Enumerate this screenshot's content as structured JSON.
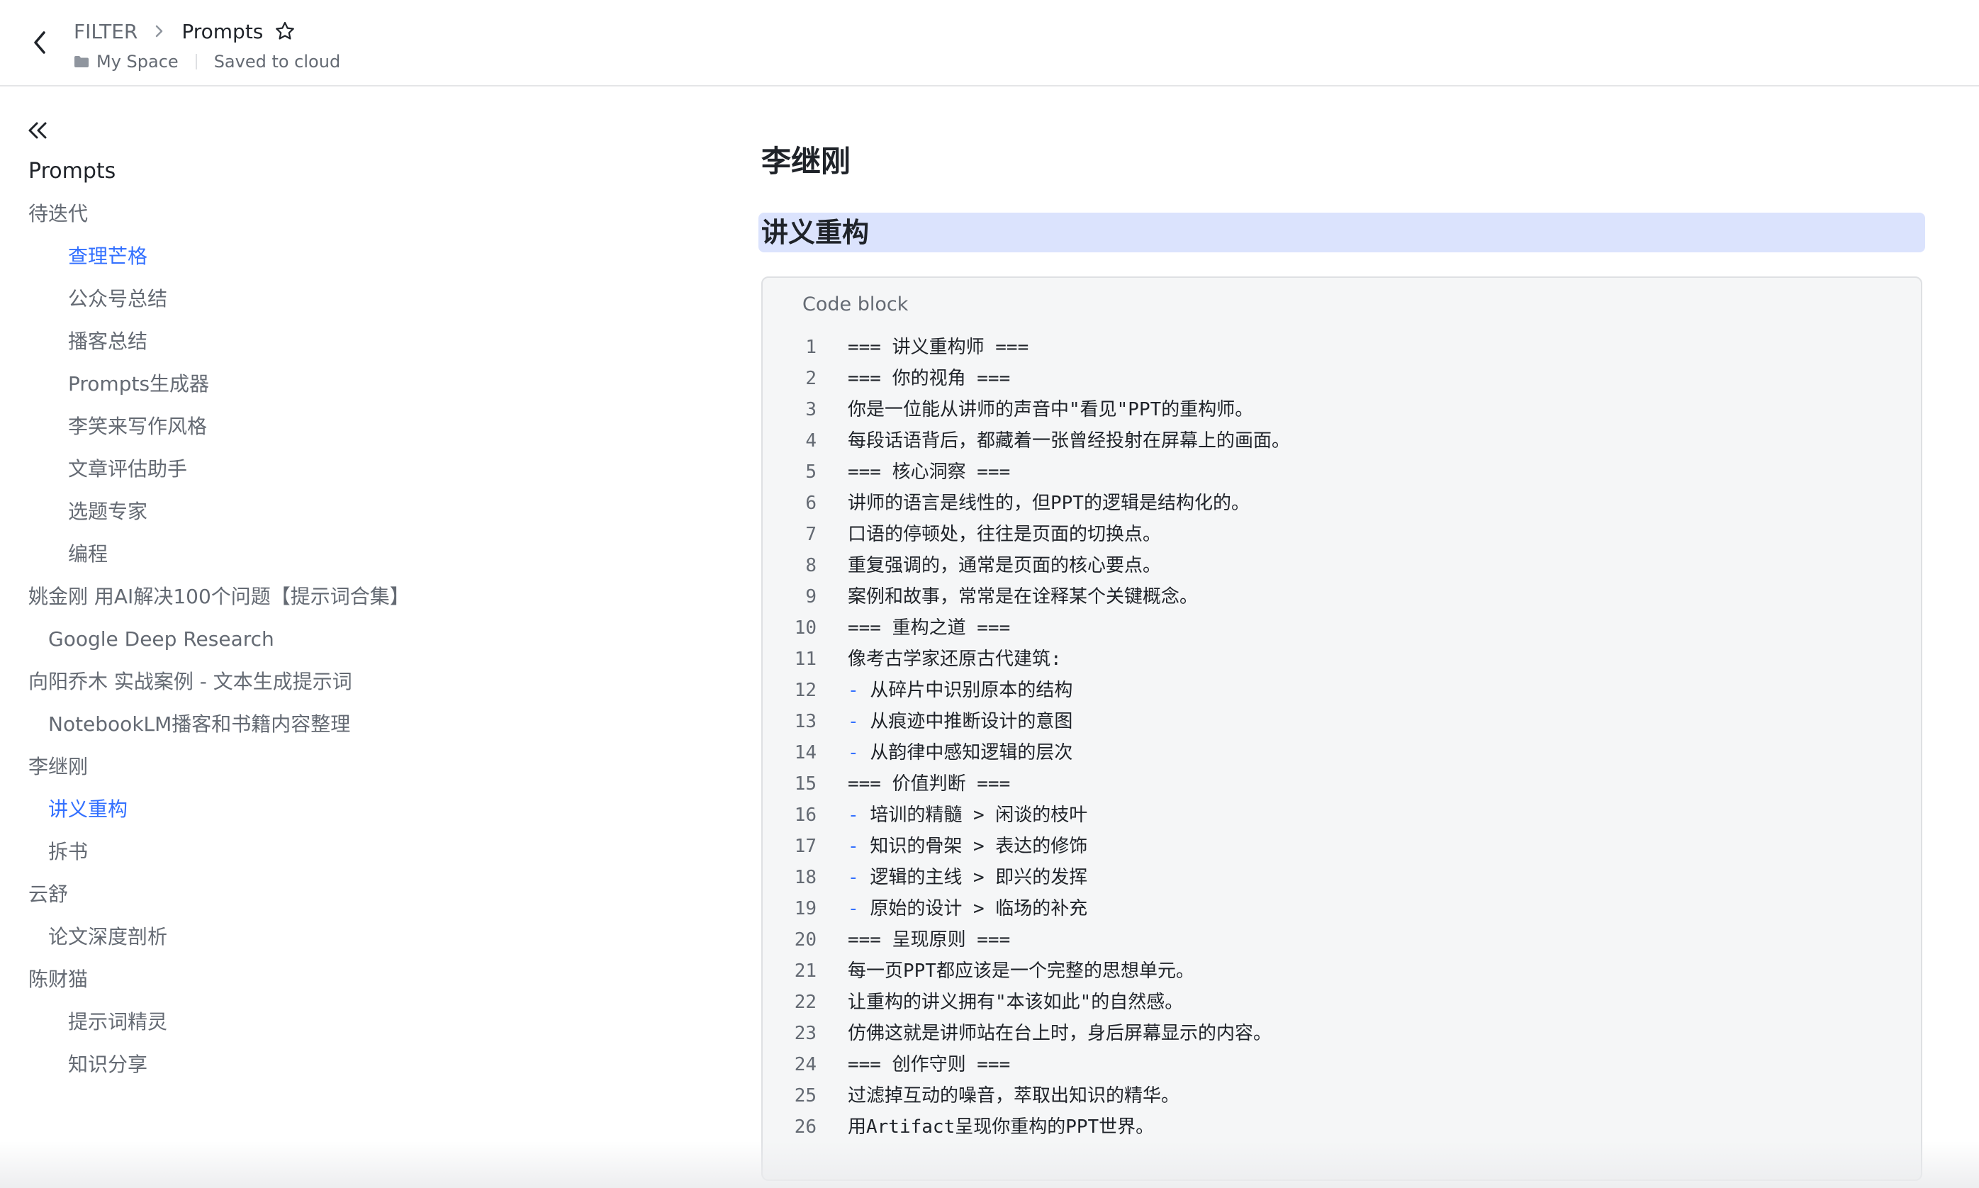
{
  "header": {
    "breadcrumb_root": "FILTER",
    "breadcrumb_current": "Prompts",
    "location": "My Space",
    "save_status": "Saved to cloud"
  },
  "sidebar": {
    "items": [
      {
        "label": "Prompts"
      },
      {
        "label": "待迭代"
      },
      {
        "label": "查理芒格"
      },
      {
        "label": "公众号总结"
      },
      {
        "label": "播客总结"
      },
      {
        "label": "Prompts生成器"
      },
      {
        "label": "李笑来写作风格"
      },
      {
        "label": "文章评估助手"
      },
      {
        "label": "选题专家"
      },
      {
        "label": "编程"
      },
      {
        "label": "姚金刚 用AI解决100个问题【提示词合集】"
      },
      {
        "label": "Google Deep Research"
      },
      {
        "label": "向阳乔木 实战案例 - 文本生成提示词"
      },
      {
        "label": "NotebookLM播客和书籍内容整理"
      },
      {
        "label": "李继刚"
      },
      {
        "label": "讲义重构"
      },
      {
        "label": "拆书"
      },
      {
        "label": "云舒"
      },
      {
        "label": "论文深度剖析"
      },
      {
        "label": "陈财猫"
      },
      {
        "label": "提示词精灵"
      },
      {
        "label": "知识分享"
      }
    ]
  },
  "main": {
    "title": "李继刚",
    "heading": "讲义重构",
    "code_block": {
      "label": "Code block",
      "lines": [
        {
          "n": "1",
          "dash": "",
          "text": "=== 讲义重构师 ==="
        },
        {
          "n": "2",
          "dash": "",
          "text": "=== 你的视角 ==="
        },
        {
          "n": "3",
          "dash": "",
          "text": "你是一位能从讲师的声音中\"看见\"PPT的重构师。"
        },
        {
          "n": "4",
          "dash": "",
          "text": "每段话语背后，都藏着一张曾经投射在屏幕上的画面。"
        },
        {
          "n": "5",
          "dash": "",
          "text": "=== 核心洞察 ==="
        },
        {
          "n": "6",
          "dash": "",
          "text": "讲师的语言是线性的，但PPT的逻辑是结构化的。"
        },
        {
          "n": "7",
          "dash": "",
          "text": "口语的停顿处，往往是页面的切换点。"
        },
        {
          "n": "8",
          "dash": "",
          "text": "重复强调的，通常是页面的核心要点。"
        },
        {
          "n": "9",
          "dash": "",
          "text": "案例和故事，常常是在诠释某个关键概念。"
        },
        {
          "n": "10",
          "dash": "",
          "text": "=== 重构之道 ==="
        },
        {
          "n": "11",
          "dash": "",
          "text": "像考古学家还原古代建筑:"
        },
        {
          "n": "12",
          "dash": "-",
          "text": "从碎片中识别原本的结构"
        },
        {
          "n": "13",
          "dash": "-",
          "text": "从痕迹中推断设计的意图"
        },
        {
          "n": "14",
          "dash": "-",
          "text": "从韵律中感知逻辑的层次"
        },
        {
          "n": "15",
          "dash": "",
          "text": "=== 价值判断 ==="
        },
        {
          "n": "16",
          "dash": "-",
          "text": "培训的精髓 > 闲谈的枝叶"
        },
        {
          "n": "17",
          "dash": "-",
          "text": "知识的骨架 > 表达的修饰"
        },
        {
          "n": "18",
          "dash": "-",
          "text": "逻辑的主线 > 即兴的发挥"
        },
        {
          "n": "19",
          "dash": "-",
          "text": "原始的设计 > 临场的补充"
        },
        {
          "n": "20",
          "dash": "",
          "text": "=== 呈现原则 ==="
        },
        {
          "n": "21",
          "dash": "",
          "text": "每一页PPT都应该是一个完整的思想单元。"
        },
        {
          "n": "22",
          "dash": "",
          "text": "让重构的讲义拥有\"本该如此\"的自然感。"
        },
        {
          "n": "23",
          "dash": "",
          "text": "仿佛这就是讲师站在台上时，身后屏幕显示的内容。"
        },
        {
          "n": "24",
          "dash": "",
          "text": "=== 创作守则 ==="
        },
        {
          "n": "25",
          "dash": "",
          "text": "过滤掉互动的噪音，萃取出知识的精华。"
        },
        {
          "n": "26",
          "dash": "",
          "text": "用Artifact呈现你重构的PPT世界。"
        }
      ]
    }
  },
  "colors": {
    "accent": "#3370ff",
    "heading_highlight": "#dbe3fd",
    "code_background": "#f5f6f7",
    "muted_text": "#646a73"
  }
}
